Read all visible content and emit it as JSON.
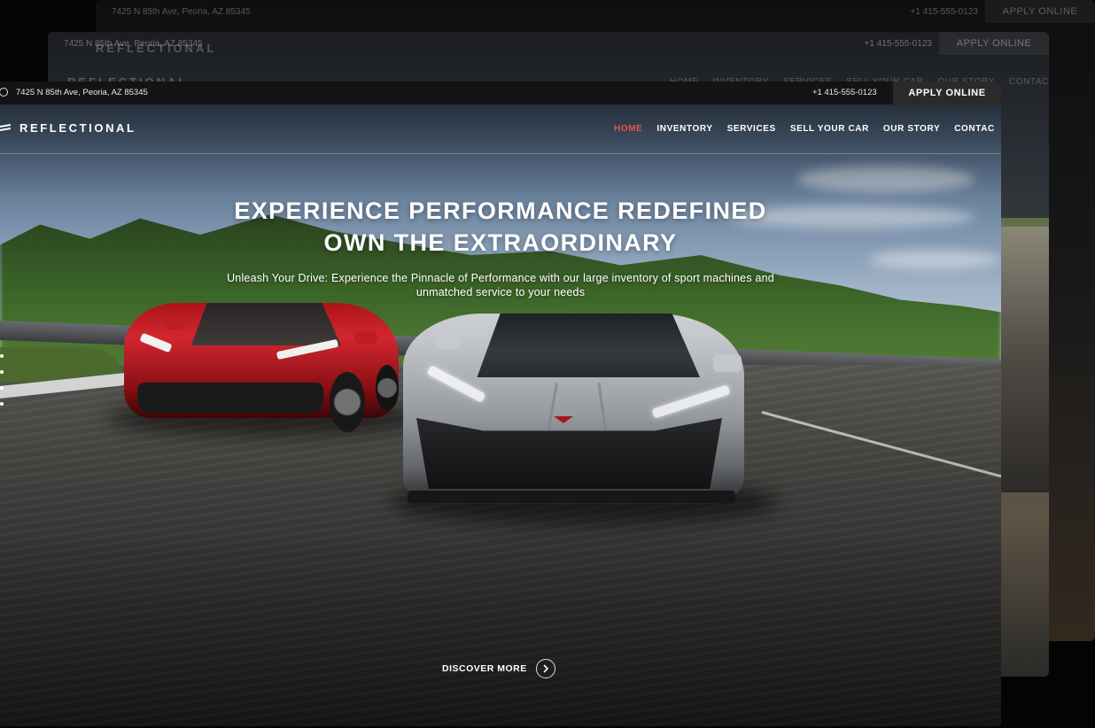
{
  "ghost_back": {
    "address": "7425 N 85th Ave, Peoria, AZ 85345",
    "phone": "+1 415-555-0123",
    "apply": "APPLY ONLINE"
  },
  "ghost_mid": {
    "address": "7425 N 85th Ave, Peoria, AZ 85345",
    "phone": "+1 415-555-0123",
    "apply": "APPLY ONLINE",
    "logo": "REFLECTIONAL",
    "nav": [
      "HOME",
      "INVENTORY",
      "SERVICES",
      "SELL YOUR CAR",
      "OUR STORY",
      "CONTAC"
    ]
  },
  "topbar": {
    "address": "7425 N 85th Ave, Peoria, AZ 85345",
    "phone": "+1 415-555-0123",
    "apply_label": "APPLY ONLINE"
  },
  "brand": {
    "name": "REFLECTIONAL"
  },
  "nav": {
    "items": [
      {
        "label": "HOME",
        "active": true
      },
      {
        "label": "INVENTORY"
      },
      {
        "label": "SERVICES"
      },
      {
        "label": "SELL YOUR CAR"
      },
      {
        "label": "OUR STORY"
      },
      {
        "label": "CONTAC"
      }
    ]
  },
  "hero": {
    "title_line1": "EXPERIENCE PERFORMANCE REDEFINED",
    "title_line2": "OWN THE EXTRAORDINARY",
    "subtitle": "Unleash Your Drive: Experience the Pinnacle of Performance with our large inventory of sport machines and unmatched service to your needs",
    "cta_label": "DISCOVER MORE"
  },
  "colors": {
    "accent": "#e8524a",
    "topbar_bg": "#121212",
    "apply_bg": "#2a2a2a"
  },
  "icons": {
    "location": "map-pin-icon",
    "logo": "logo-mark-icon",
    "cta": "chevron-right-icon"
  }
}
